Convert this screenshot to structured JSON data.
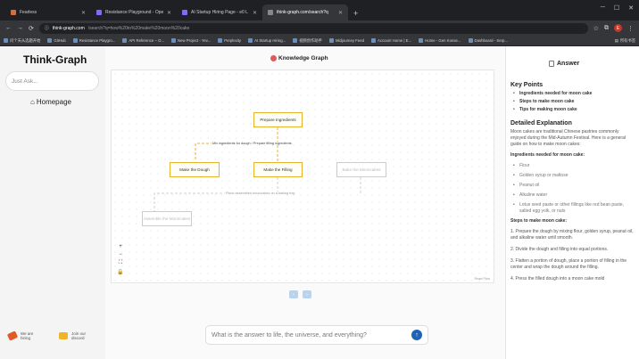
{
  "browser": {
    "tabs": [
      {
        "label": "Fearless",
        "active": false
      },
      {
        "label": "Resistance Playground - Ope",
        "active": false
      },
      {
        "label": "AI Startup Hiring Page - e0 L",
        "active": false
      },
      {
        "label": "think-graph.com/search?q",
        "active": true
      }
    ],
    "url_host": "think-graph.com",
    "url_path": "/search?q=how%20to%20make%20moon%20cake",
    "avatar_letter": "E",
    "bookmarks": [
      "问个天从选题开始",
      "GitHub",
      "Resistance Playgro...",
      "API Reference – O...",
      "New Project - Yev...",
      "Perplexity",
      "AI Startup Hiring...",
      "视频创作助手",
      "Midjourney Feed",
      "Account Home | E...",
      "Home - Gen Konse...",
      "Dashboard - Serp..."
    ],
    "all_bookmarks": "所有书签"
  },
  "sidebar": {
    "brand": "Think-Graph",
    "ask_placeholder": "Just Ask...",
    "homepage": "Homepage",
    "promos": [
      {
        "text_line1": "We are",
        "text_line2": "hiring",
        "color": "#e05a28"
      },
      {
        "text_line1": "Join our",
        "text_line2": "discord",
        "color": "#f0b429"
      }
    ]
  },
  "graph": {
    "title": "Knowledge Graph",
    "nodes": {
      "prepare": "Prepare Ingredients",
      "dough": "Make the Dough",
      "filling": "Make the Filling",
      "assemble": "Assemble the Mooncakes",
      "bake": "Bake the Mooncakes"
    },
    "edges": {
      "mix": "Mix ingredients for dough / Prepare filling ingredients",
      "assemble": "Place assembled mooncakes on a baking tray"
    },
    "controls": [
      "+",
      "−",
      "⛶",
      "🔒"
    ],
    "attribution": "React Flow"
  },
  "chat": {
    "placeholder": "What is the answer to life, the universe, and everything?",
    "send": "↑"
  },
  "answer": {
    "title": "Answer",
    "key_points_title": "Key Points",
    "key_points": [
      "Ingredients needed for moon cake",
      "Steps to make moon cake",
      "Tips for making moon cake"
    ],
    "detail_title": "Detailed Explanation",
    "intro": "Moon cakes are traditional Chinese pastries commonly enjoyed during the Mid-Autumn Festival. Here is a general guide on how to make moon cakes:",
    "ingredients_title": "Ingredients needed for moon cake:",
    "ingredients": [
      "Flour",
      "Golden syrup or maltose",
      "Peanut oil",
      "Alkaline water",
      "Lotus seed paste or other fillings like red bean paste, salted egg yolk, or nuts"
    ],
    "steps_title": "Steps to make moon cake:",
    "steps": [
      "1. Prepare the dough by mixing flour, golden syrup, peanut oil, and alkaline water until smooth.",
      "2. Divide the dough and filling into equal portions.",
      "3. Flatten a portion of dough, place a portion of filling in the center and wrap the dough around the filling.",
      "4. Press the filled dough into a moon cake mold"
    ]
  }
}
